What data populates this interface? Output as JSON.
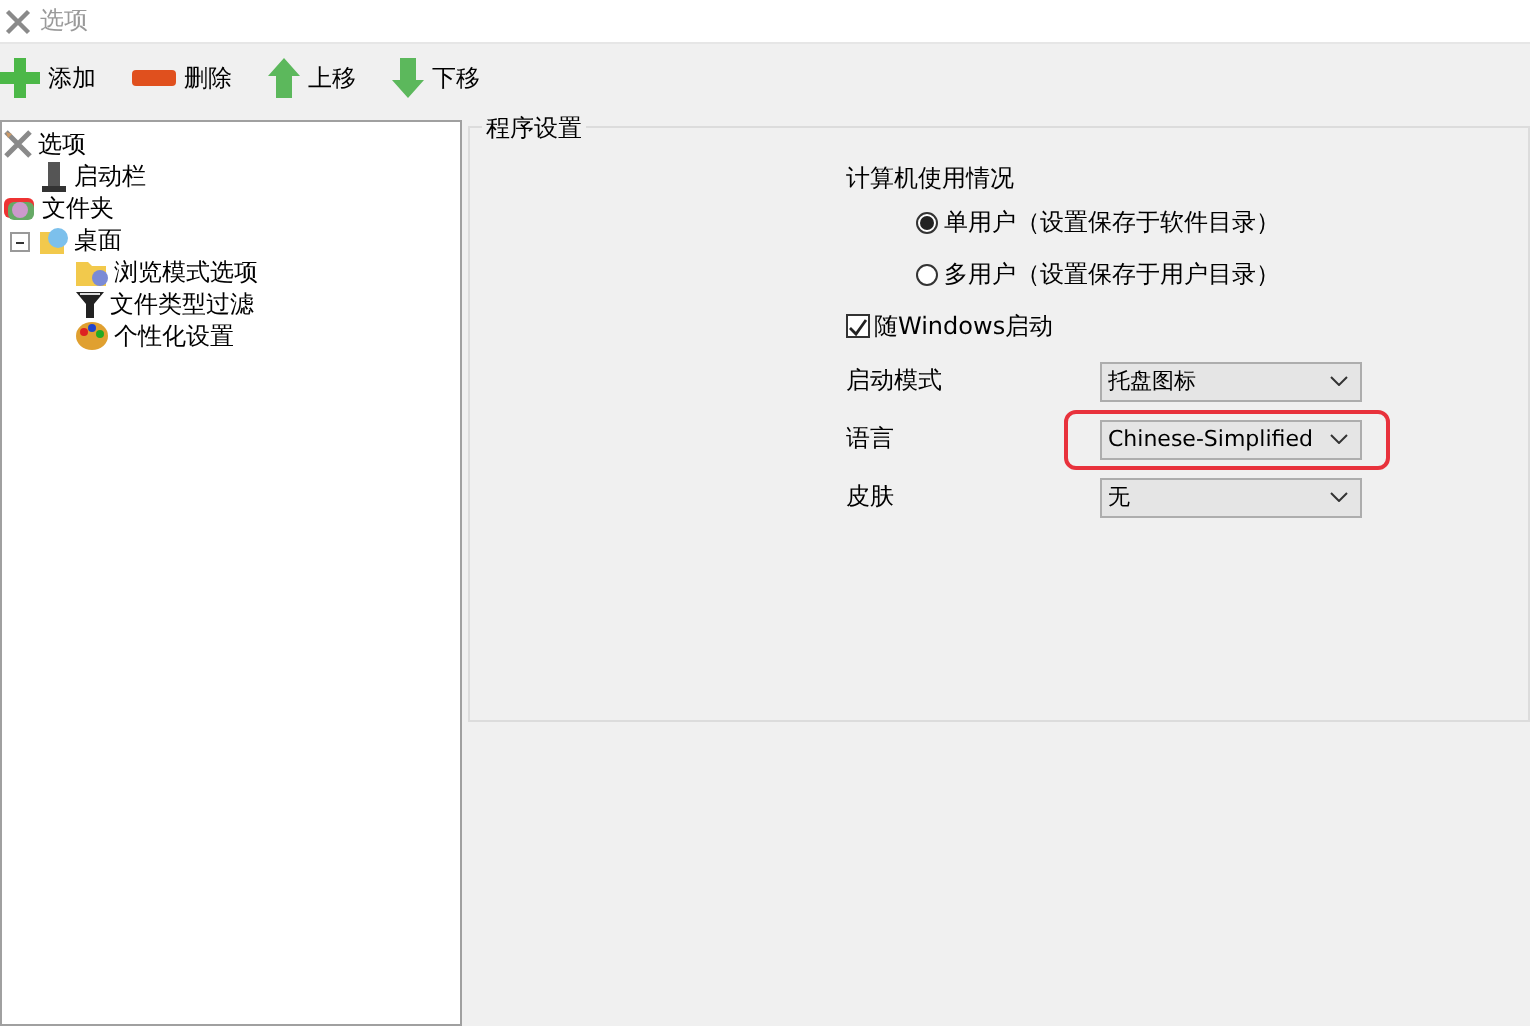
{
  "window": {
    "title": "选项"
  },
  "toolbar": [
    {
      "kind": "add",
      "label": "添加"
    },
    {
      "kind": "remove",
      "label": "删除"
    },
    {
      "kind": "up",
      "label": "上移"
    },
    {
      "kind": "down",
      "label": "下移"
    }
  ],
  "tree": [
    {
      "label": "选项",
      "children": [
        {
          "label": "启动栏"
        }
      ]
    },
    {
      "label": "文件夹",
      "children": [
        {
          "label": "桌面",
          "expanded": true,
          "children": [
            {
              "label": "浏览模式选项"
            },
            {
              "label": "文件类型过滤"
            },
            {
              "label": "个性化设置"
            }
          ]
        }
      ]
    }
  ],
  "settings": {
    "title": "程序设置",
    "rows": [
      {
        "kind": "heading",
        "label": "计算机使用情况"
      },
      {
        "kind": "radio",
        "label": "单用户（设置保存于软件目录）",
        "selected": true
      },
      {
        "kind": "radio",
        "label": "多用户（设置保存于用户目录）",
        "selected": false
      },
      {
        "kind": "checkbox",
        "label": "随Windows启动",
        "checked": true
      },
      {
        "kind": "dropdown",
        "label": "启动模式",
        "value": "托盘图标",
        "highlighted": false
      },
      {
        "kind": "dropdown",
        "label": "语言",
        "value": "Chinese-Simplified",
        "highlighted": true
      },
      {
        "kind": "dropdown",
        "label": "皮肤",
        "value": "无",
        "highlighted": false
      }
    ]
  }
}
